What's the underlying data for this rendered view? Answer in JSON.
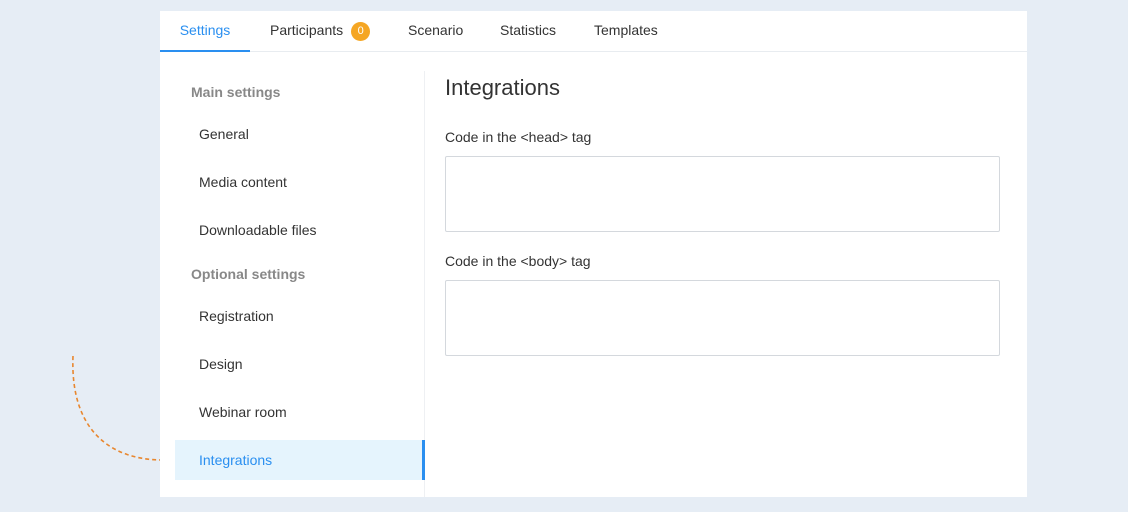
{
  "tabs": {
    "settings": "Settings",
    "participants": "Participants",
    "participants_count": "0",
    "scenario": "Scenario",
    "statistics": "Statistics",
    "templates": "Templates"
  },
  "sidebar": {
    "main_title": "Main settings",
    "main_items": [
      "General",
      "Media content",
      "Downloadable files"
    ],
    "optional_title": "Optional settings",
    "optional_items": [
      "Registration",
      "Design",
      "Webinar room",
      "Integrations"
    ]
  },
  "content": {
    "heading": "Integrations",
    "head_label": "Code in the <head> tag",
    "head_value": "",
    "body_label": "Code in the <body> tag",
    "body_value": ""
  },
  "colors": {
    "accent": "#2a8ff0",
    "badge": "#f5a623",
    "annotation_arrow": "#e8872f",
    "active_bg": "#e5f4fd"
  }
}
